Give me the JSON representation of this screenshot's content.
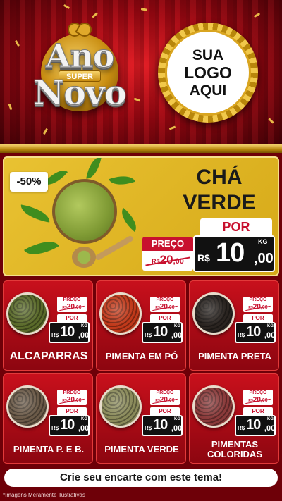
{
  "header": {
    "title_top": "Ano",
    "title_badge": "SUPER",
    "title_bottom": "Novo",
    "logo_lines": [
      "SUA",
      "LOGO",
      "AQUI"
    ]
  },
  "featured": {
    "discount": "-50%",
    "name_line1": "CHÁ",
    "name_line2": "VERDE",
    "preco_label": "PREÇO",
    "old_price": {
      "currency": "R$",
      "integer": "20",
      "decimals": ",00"
    },
    "por_label": "POR",
    "new_price": {
      "currency": "R$",
      "integer": "10",
      "decimals": ",00",
      "unit": "KG"
    }
  },
  "labels": {
    "preco": "PREÇO",
    "por": "POR",
    "unit": "KG",
    "currency": "R$"
  },
  "products": [
    {
      "name": "ALCAPARRAS",
      "old_int": "20",
      "old_dec": ",00",
      "new_int": "10",
      "new_dec": ",00",
      "color": "#5a6a2a"
    },
    {
      "name": "PIMENTA EM PÓ",
      "old_int": "20",
      "old_dec": ",00",
      "new_int": "10",
      "new_dec": ",00",
      "color": "#c0391a"
    },
    {
      "name": "PIMENTA PRETA",
      "old_int": "20",
      "old_dec": ",00",
      "new_int": "10",
      "new_dec": ",00",
      "color": "#2a2420"
    },
    {
      "name": "PIMENTA P. E B.",
      "old_int": "20",
      "old_dec": ",00",
      "new_int": "10",
      "new_dec": ",00",
      "color": "#6b5a48"
    },
    {
      "name": "PIMENTA VERDE",
      "old_int": "20",
      "old_dec": ",00",
      "new_int": "10",
      "new_dec": ",00",
      "color": "#8a8a5a"
    },
    {
      "name_line1": "PIMENTAS",
      "name_line2": "COLORIDAS",
      "old_int": "20",
      "old_dec": ",00",
      "new_int": "10",
      "new_dec": ",00",
      "color": "#8a3a3a"
    }
  ],
  "cta": "Crie seu encarte com este tema!",
  "disclaimer": "*Imagens Meramente Ilustrativas"
}
